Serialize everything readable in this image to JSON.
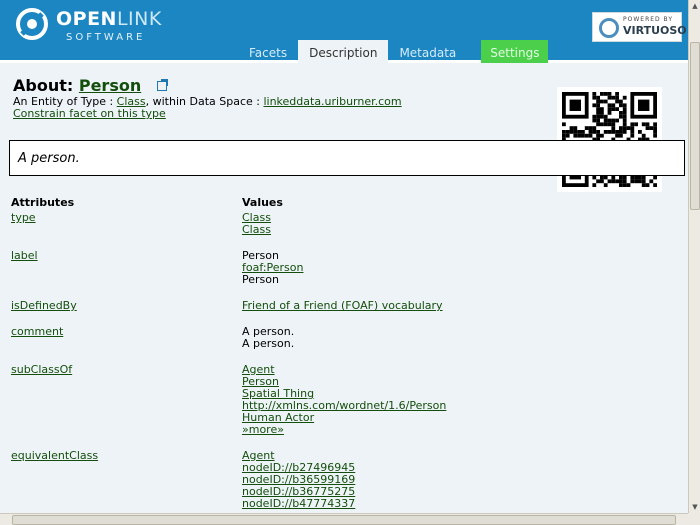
{
  "header": {
    "logo_word_main": "OPEN",
    "logo_word_light": "LINK",
    "logo_sub": "SOFTWARE",
    "powered_by": "POWERED BY",
    "virtuoso": "VIRTUOSO"
  },
  "tabs": [
    {
      "label": "Facets",
      "active": false
    },
    {
      "label": "Description",
      "active": true
    },
    {
      "label": "Metadata",
      "active": false
    },
    {
      "label": "Settings",
      "active": false
    }
  ],
  "about": {
    "prefix": "About:",
    "title": "Person",
    "entity_prefix": "An Entity of Type : ",
    "entity_type": "Class",
    "within": ", within Data Space : ",
    "dataspace": "linkeddata.uriburner.com",
    "constrain": "Constrain facet on this type"
  },
  "description": "A person.",
  "table": {
    "col_attr": "Attributes",
    "col_vals": "Values",
    "rows": [
      {
        "attr": "type",
        "values": [
          {
            "t": "Class",
            "link": true
          },
          {
            "t": "Class",
            "link": true
          }
        ]
      },
      {
        "attr": "label",
        "values": [
          {
            "t": "Person",
            "link": false
          },
          {
            "t": "foaf:Person",
            "link": true
          },
          {
            "t": "Person",
            "link": false
          }
        ]
      },
      {
        "attr": "isDefinedBy",
        "values": [
          {
            "t": "Friend of a Friend (FOAF) vocabulary",
            "link": true
          }
        ]
      },
      {
        "attr": "comment",
        "values": [
          {
            "t": "A person.",
            "link": false
          },
          {
            "t": "A person.",
            "link": false
          }
        ]
      },
      {
        "attr": "subClassOf",
        "values": [
          {
            "t": "Agent",
            "link": true
          },
          {
            "t": "Person",
            "link": true
          },
          {
            "t": "Spatial Thing",
            "link": true
          },
          {
            "t": "http://xmlns.com/wordnet/1.6/Person",
            "link": true
          },
          {
            "t": "Human Actor",
            "link": true
          },
          {
            "t": "»more»",
            "link": true
          }
        ]
      },
      {
        "attr": "equivalentClass",
        "values": [
          {
            "t": "Agent",
            "link": true
          },
          {
            "t": "nodeID://b27496945",
            "link": true
          },
          {
            "t": "nodeID://b36599169",
            "link": true
          },
          {
            "t": "nodeID://b36775275",
            "link": true
          },
          {
            "t": "nodeID://b47774337",
            "link": true
          }
        ]
      }
    ]
  },
  "colors": {
    "header_bg": "#1b86c2",
    "page_bg": "#eef3f7",
    "link": "#134e0c",
    "settings_tab": "#4cd04c"
  }
}
